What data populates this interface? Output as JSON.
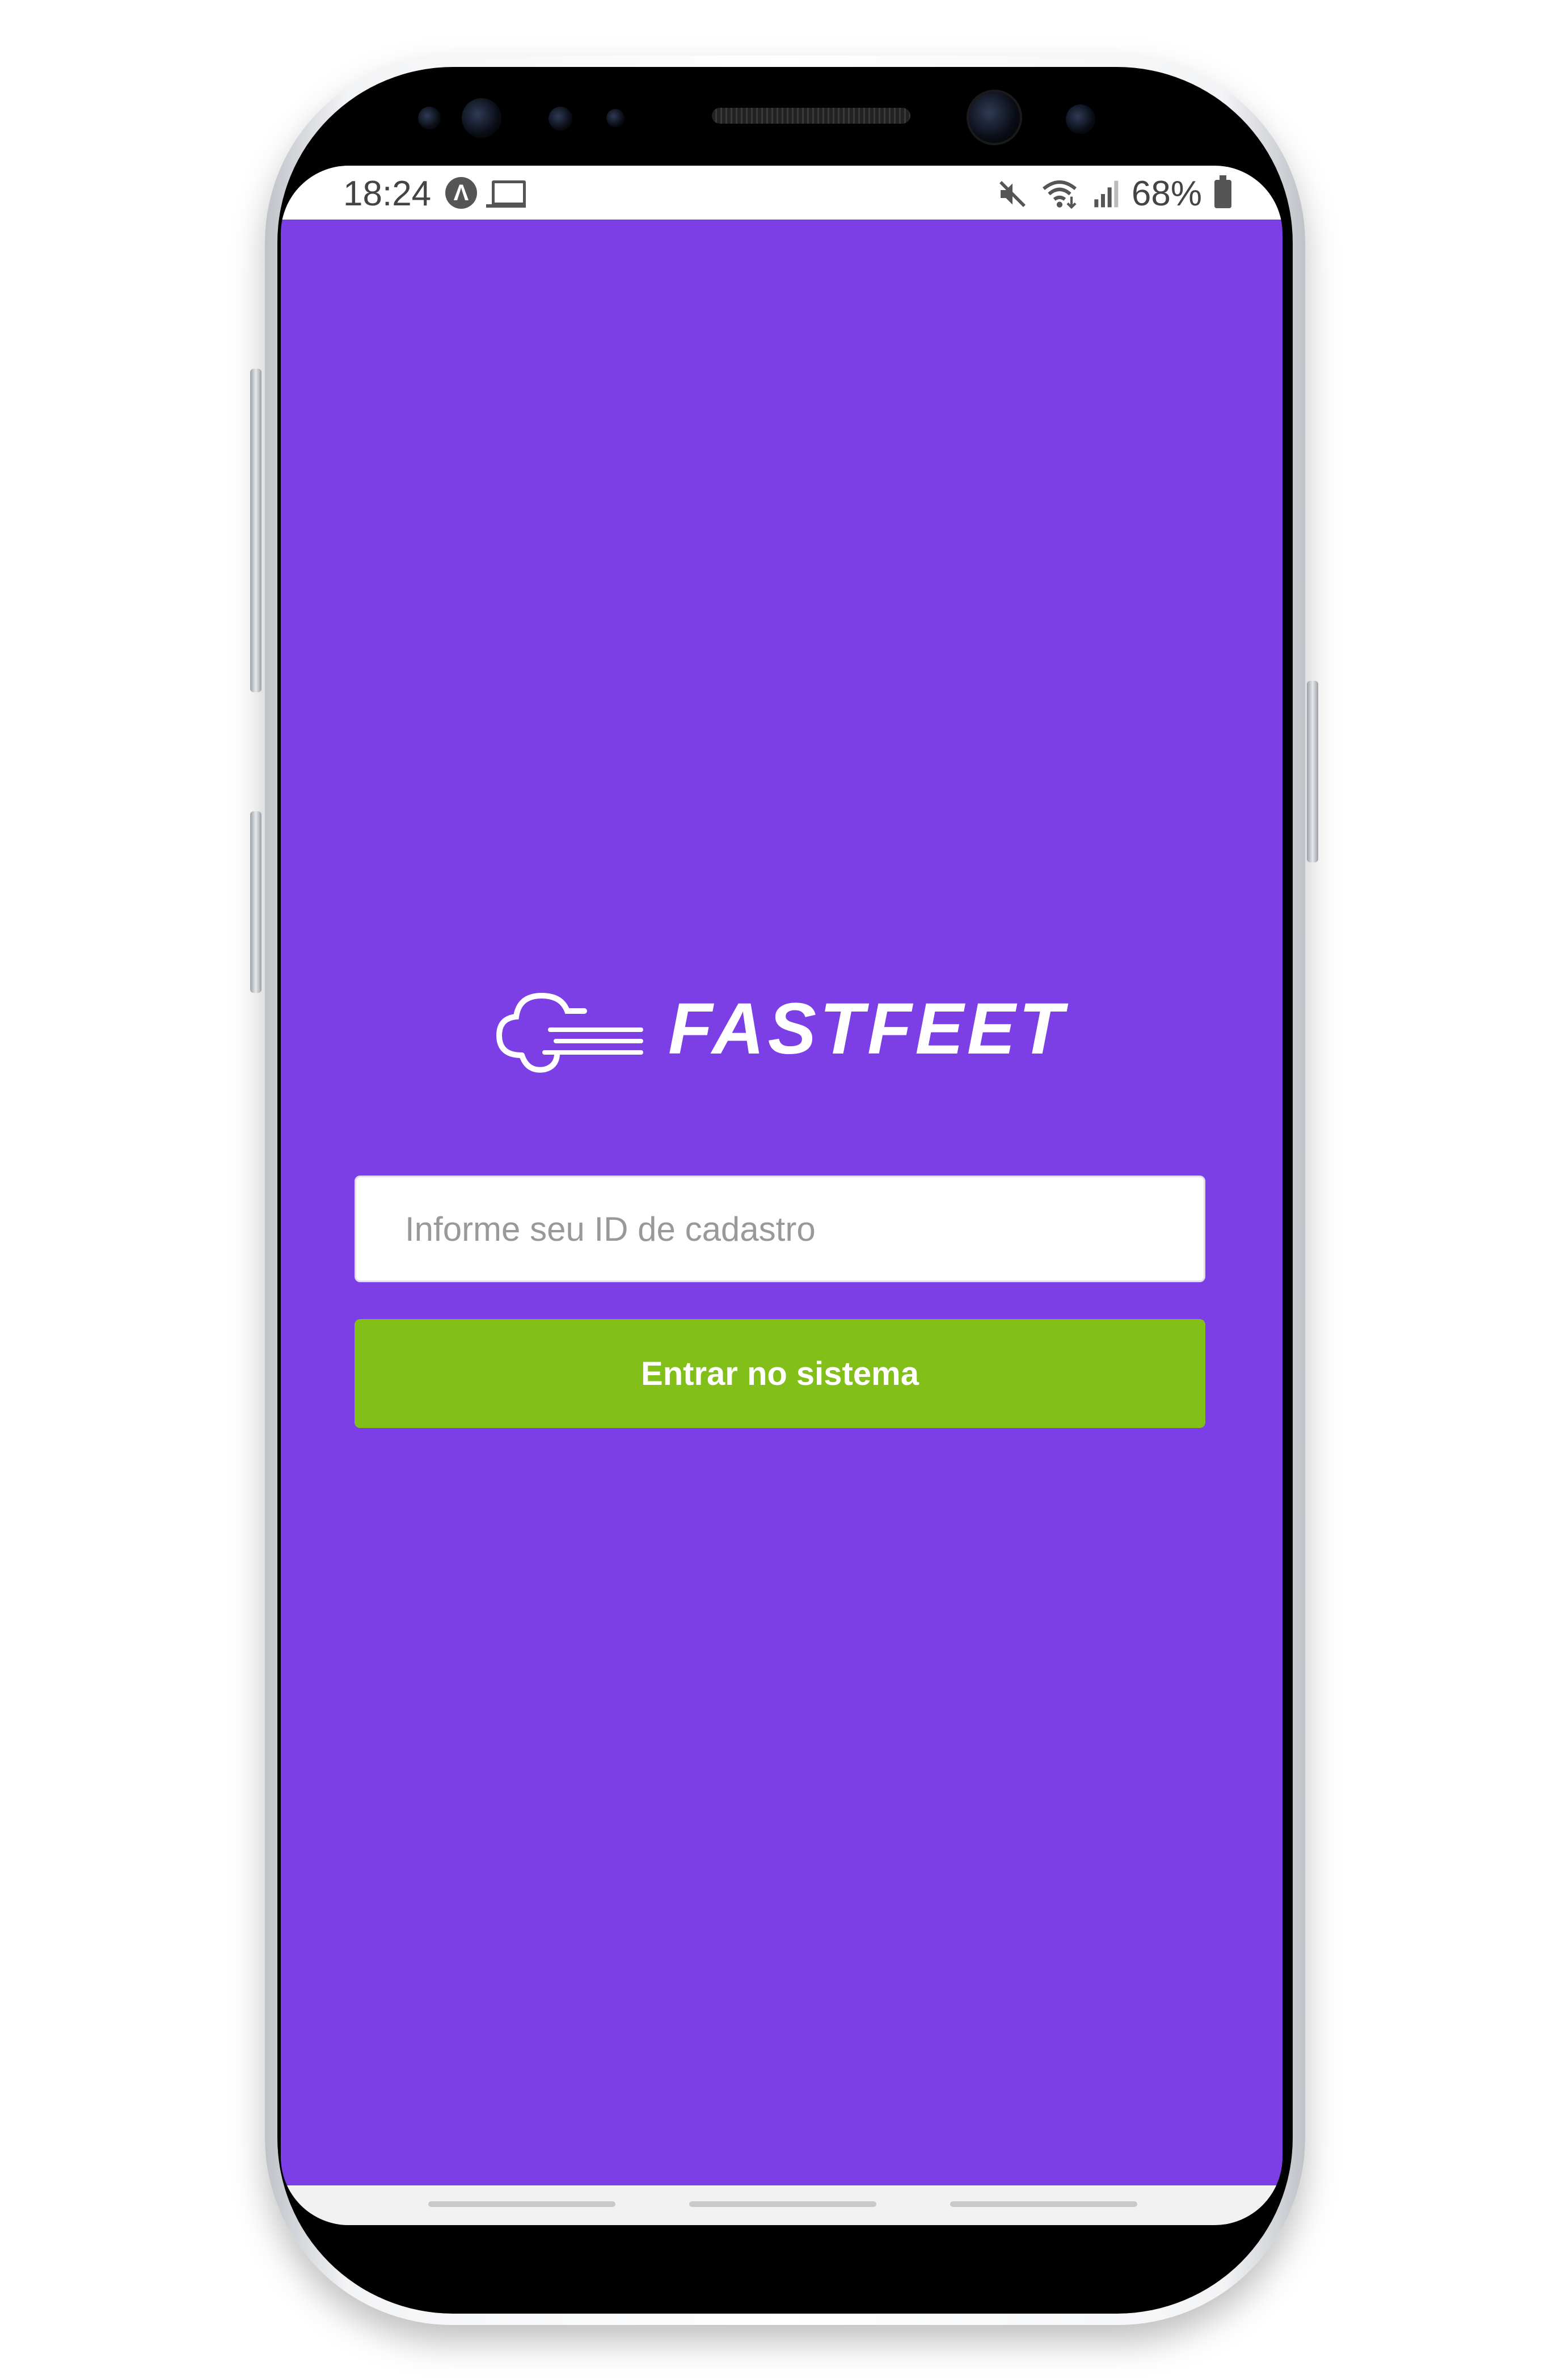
{
  "status_bar": {
    "time": "18:24",
    "battery_percent": "68%",
    "icons": [
      "android-auto-icon",
      "laptop-icon",
      "mute-icon",
      "wifi-icon",
      "signal-icon",
      "battery-icon"
    ]
  },
  "app": {
    "logo_text": "FASTFEET",
    "background_color": "#7c3fe5",
    "login_form": {
      "id_input_value": "",
      "id_input_placeholder": "Informe seu ID de cadastro",
      "submit_label": "Entrar no sistema",
      "submit_color": "#82bf18"
    }
  }
}
